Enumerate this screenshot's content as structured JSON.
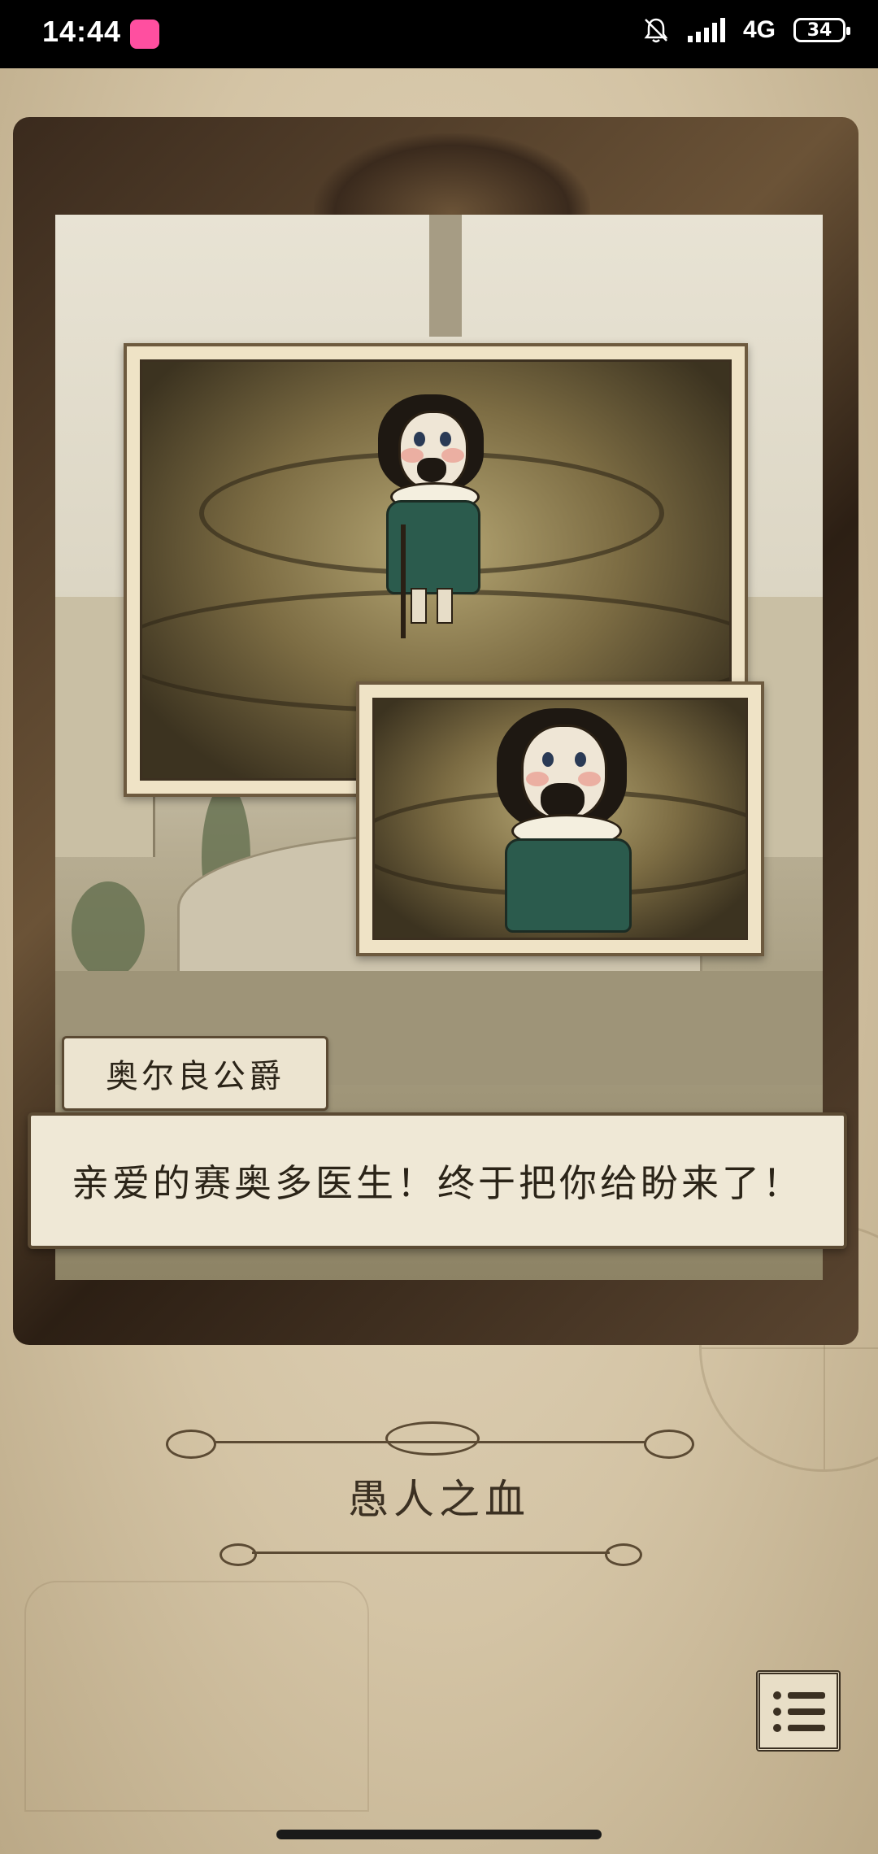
{
  "status_bar": {
    "time": "14:44",
    "network": "4G",
    "battery": "34",
    "icons": [
      "app-notification-icon",
      "mute-bell-icon",
      "signal-bars-icon",
      "battery-icon"
    ]
  },
  "scene": {
    "speaker_name": "奥尔良公爵",
    "dialog_text": "亲爱的赛奥多医生！终于把你给盼来了！",
    "chapter_title": "愚人之血"
  },
  "controls": {
    "menu_icon": "list-menu-icon"
  },
  "colors": {
    "paper": "#d4c4a5",
    "frame": "#3a2a1d",
    "ink": "#2b2418",
    "coat": "#2b5b4d"
  }
}
